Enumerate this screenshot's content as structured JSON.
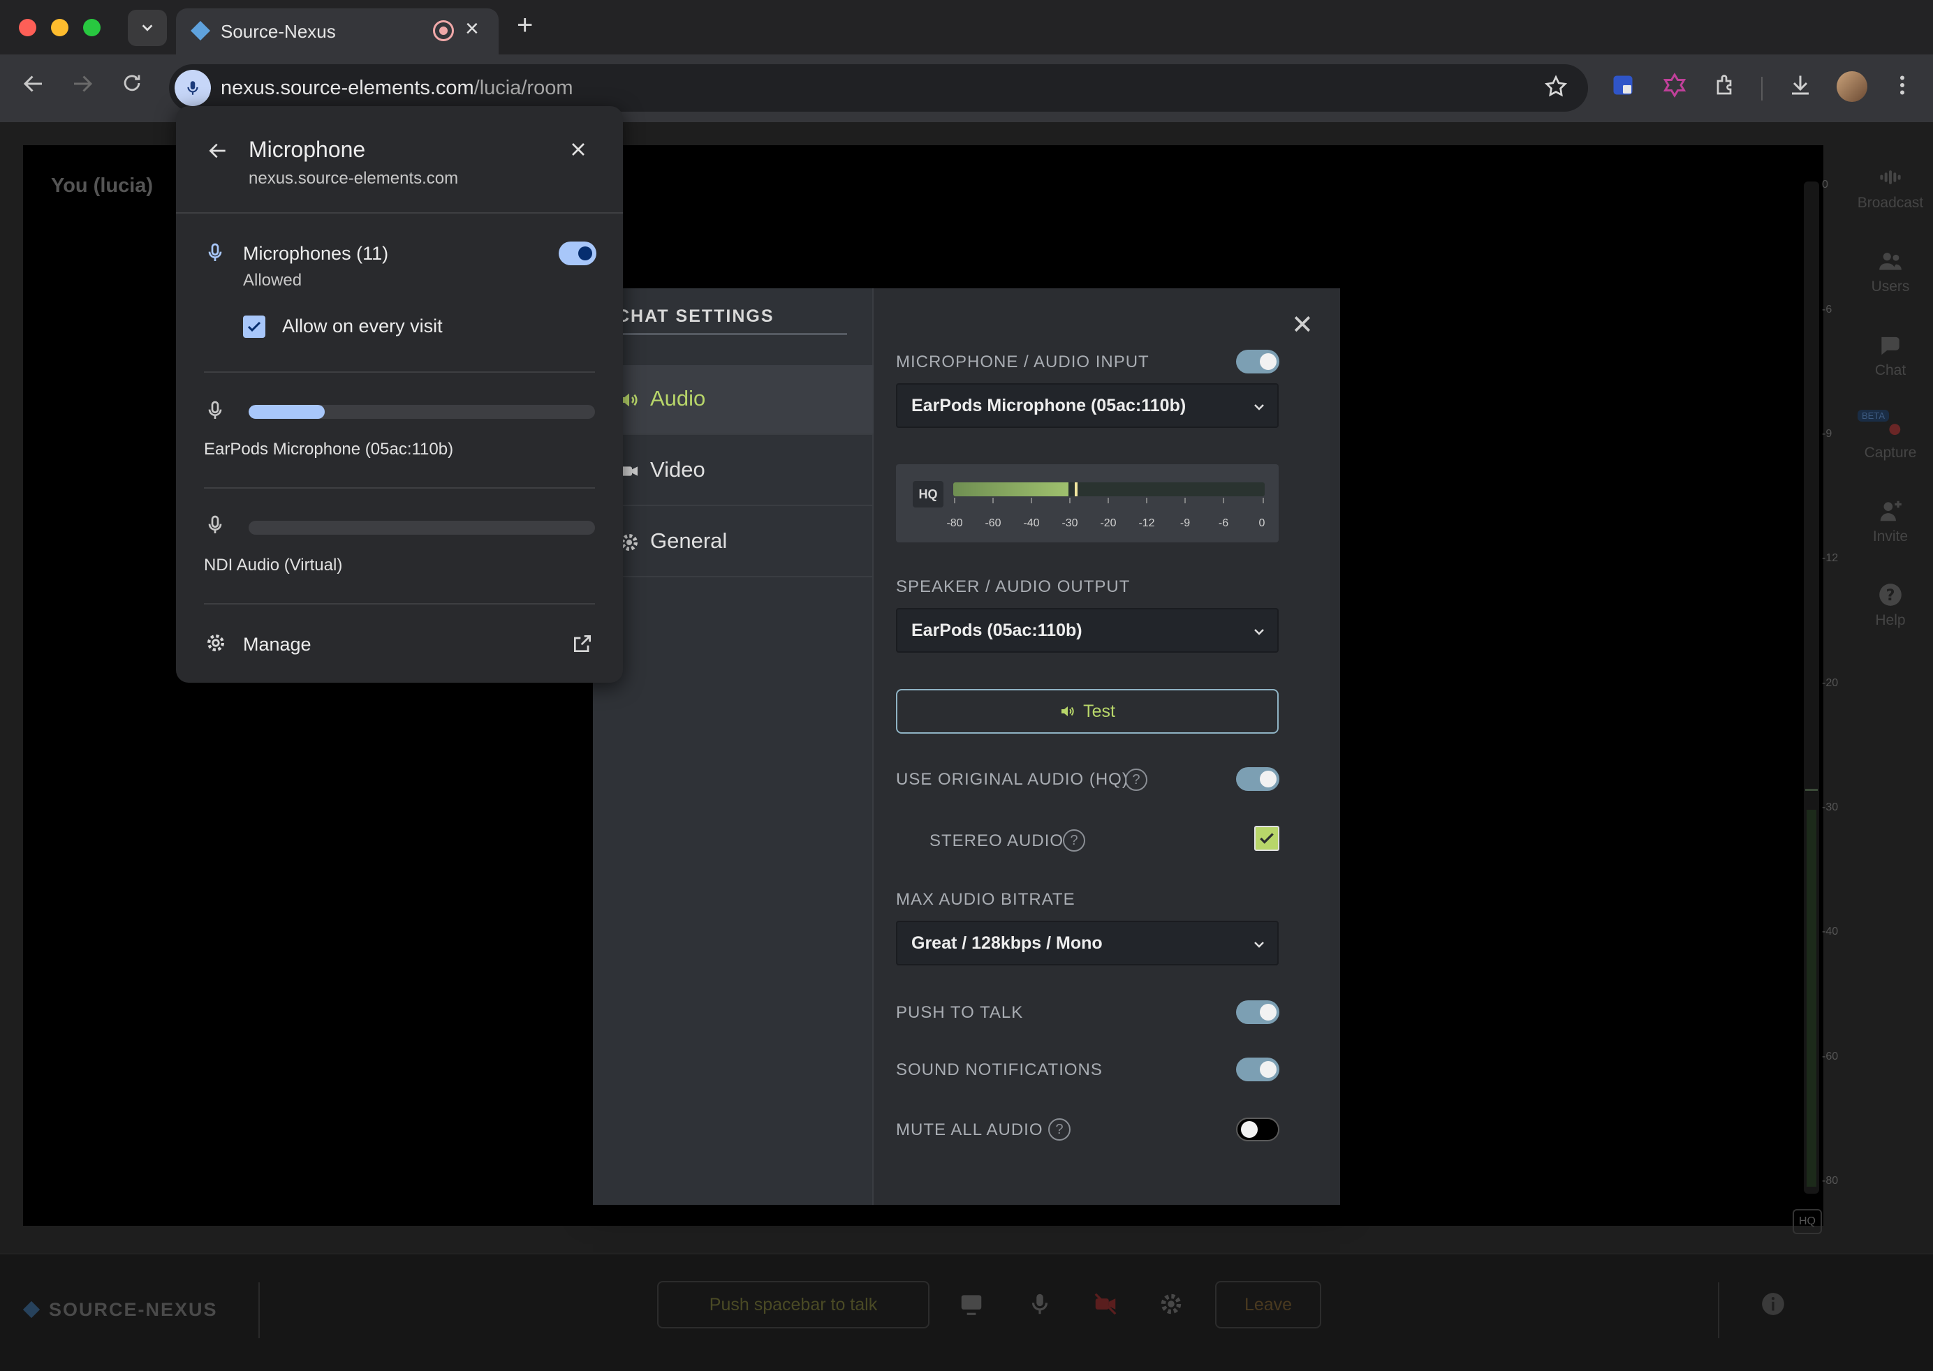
{
  "browser": {
    "tab_title": "Source-Nexus",
    "url_host": "nexus.source-elements.com",
    "url_path": "/lucia/room"
  },
  "stage": {
    "you_label": "You (lucia)",
    "vu_scale": [
      "0",
      "-6",
      "-9",
      "-12",
      "-20",
      "-30",
      "-40",
      "-60",
      "-80"
    ],
    "hq_badge": "HQ"
  },
  "sidenav": {
    "items": [
      {
        "label": "Broadcast",
        "icon": "broadcast-icon"
      },
      {
        "label": "Users",
        "icon": "users-icon"
      },
      {
        "label": "Chat",
        "icon": "chat-icon"
      },
      {
        "label": "Capture",
        "icon": "capture-icon",
        "badge": "BETA"
      },
      {
        "label": "Invite",
        "icon": "invite-icon"
      },
      {
        "label": "Help",
        "icon": "help-icon"
      }
    ]
  },
  "bottombar": {
    "brand": "SOURCE-NEXUS",
    "push_to_talk": "Push spacebar to talk",
    "leave": "Leave"
  },
  "settings": {
    "title": "CHAT SETTINGS",
    "menu": [
      {
        "label": "Audio",
        "icon": "speaker-icon",
        "active": true
      },
      {
        "label": "Video",
        "icon": "video-icon",
        "active": false
      },
      {
        "label": "General",
        "icon": "gear-icon",
        "active": false
      }
    ],
    "mic_input_label": "MICROPHONE / AUDIO INPUT",
    "mic_input_value": "EarPods Microphone (05ac:110b)",
    "meter": {
      "hq": "HQ",
      "scale": [
        "-80",
        "-60",
        "-40",
        "-30",
        "-20",
        "-12",
        "-9",
        "-6",
        "0"
      ],
      "level": 0.37,
      "peak": 0.39
    },
    "speaker_label": "SPEAKER / AUDIO OUTPUT",
    "speaker_value": "EarPods (05ac:110b)",
    "test_label": "Test",
    "original_audio_label": "USE ORIGINAL AUDIO (HQ)",
    "stereo_label": "STEREO AUDIO",
    "bitrate_label": "MAX AUDIO BITRATE",
    "bitrate_value": "Great / 128kbps / Mono",
    "ptt_label": "PUSH TO TALK",
    "sound_notif_label": "SOUND NOTIFICATIONS",
    "mute_all_label": "MUTE ALL AUDIO",
    "colors": {
      "accent": "#b8d66a",
      "toggle_on": "#7c9fb3"
    }
  },
  "permission_popup": {
    "title": "Microphone",
    "site": "nexus.source-elements.com",
    "mic_group": "Microphones (11)",
    "status": "Allowed",
    "allow_every_visit": "Allow on every visit",
    "devices": [
      {
        "name": "EarPods Microphone (05ac:110b)",
        "level": 0.22
      },
      {
        "name": "NDI Audio (Virtual)",
        "level": 0
      }
    ],
    "manage": "Manage"
  }
}
